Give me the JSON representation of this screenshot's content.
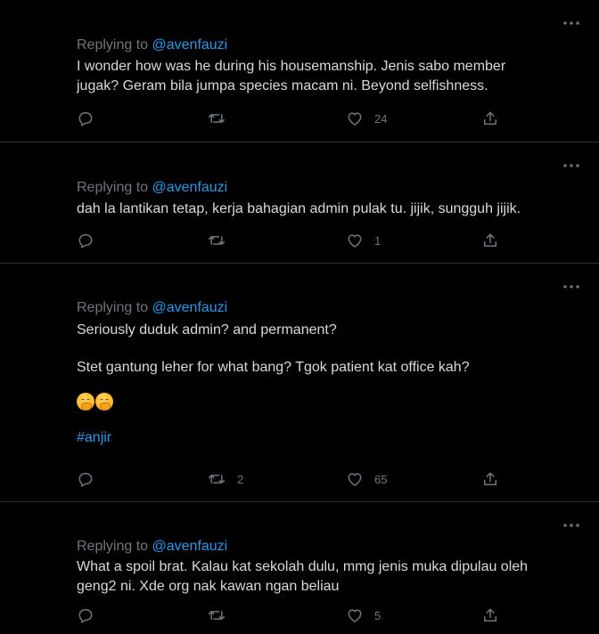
{
  "replying_prefix": "Replying to ",
  "tweets": [
    {
      "handle": "@avenfauzi",
      "text": "I wonder how was he during his housemanship. Jenis sabo member\njugak? Geram bila jumpa species macam ni. Beyond selfishness.",
      "retweets": "",
      "likes": "24"
    },
    {
      "handle": "@avenfauzi",
      "text": "dah la lantikan tetap, kerja bahagian admin pulak tu. jijik, sungguh jijik.",
      "retweets": "",
      "likes": "1"
    },
    {
      "handle": "@avenfauzi",
      "text": "Seriously duduk admin? and permanent?\n\nStet gantung leher for what bang? Tgok patient kat office kah?",
      "emoji_count": 2,
      "hashtag": "#anjir",
      "retweets": "2",
      "likes": "65"
    },
    {
      "handle": "@avenfauzi",
      "text": "What a spoil brat. Kalau kat sekolah dulu, mmg jenis muka dipulau oleh\ngeng2 ni. Xde org nak kawan ngan beliau",
      "retweets": "",
      "likes": "5"
    }
  ],
  "icons": {
    "more": "more-horizontal-icon",
    "reply": "reply-bubble-icon",
    "retweet": "retweet-icon",
    "like": "heart-icon",
    "share": "share-icon",
    "emoji": "face-with-hand-over-mouth-emoji"
  },
  "colors": {
    "background": "#000000",
    "text": "#d9d9d9",
    "muted": "#6e767d",
    "link": "#1d9bf0",
    "divider": "#2f3336"
  }
}
